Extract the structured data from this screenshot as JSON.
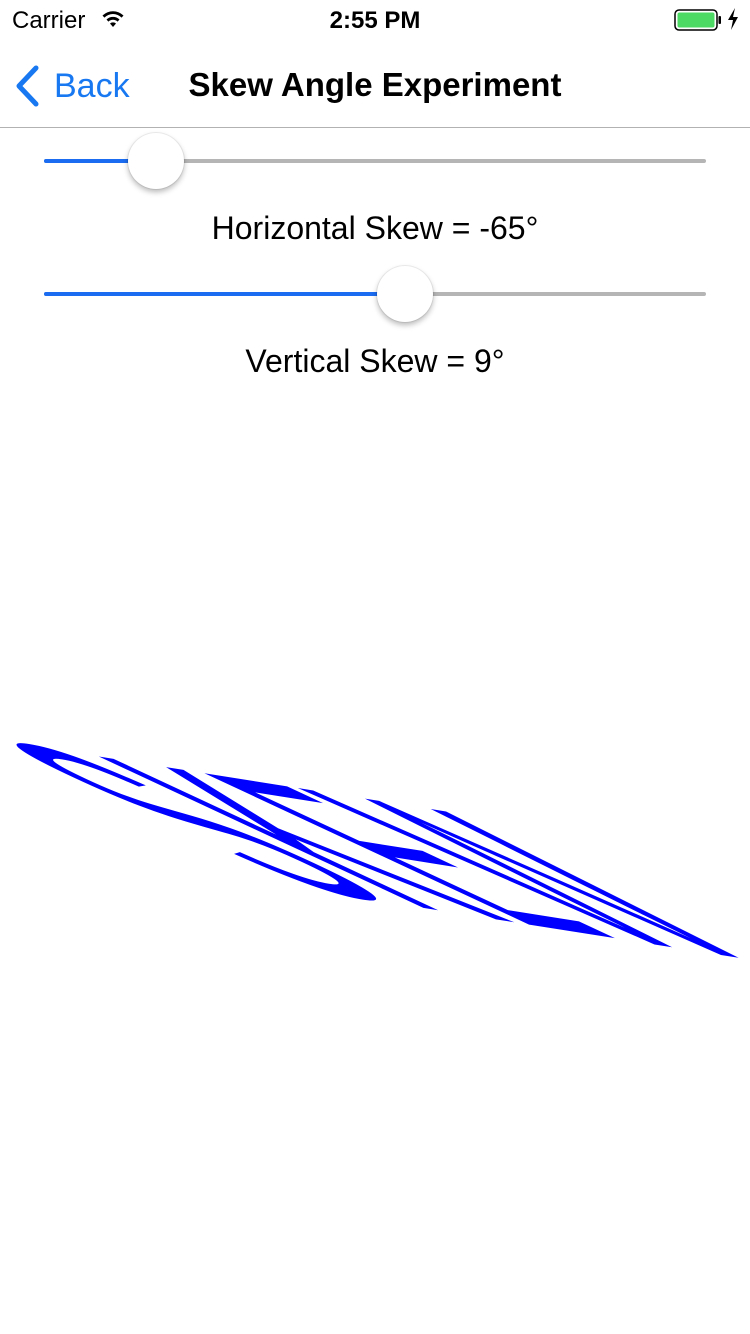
{
  "status_bar": {
    "carrier": "Carrier",
    "time": "2:55 PM",
    "battery_color": "#4cd964"
  },
  "nav": {
    "back_label": "Back",
    "title": "Skew Angle Experiment"
  },
  "sliders": [
    {
      "label": "Horizontal Skew = -65°",
      "min": -90,
      "max": 90,
      "value": -65
    },
    {
      "label": "Vertical Skew = 9°",
      "min": -90,
      "max": 90,
      "value": 9
    }
  ],
  "skew_text": {
    "text": "SKEW",
    "color": "#0000ff",
    "horizontal_skew_deg": -65,
    "vertical_skew_deg": 9
  },
  "colors": {
    "accent": "#1778f2",
    "track_fill": "#1b6cf0",
    "track_empty": "#b5b5b5"
  }
}
